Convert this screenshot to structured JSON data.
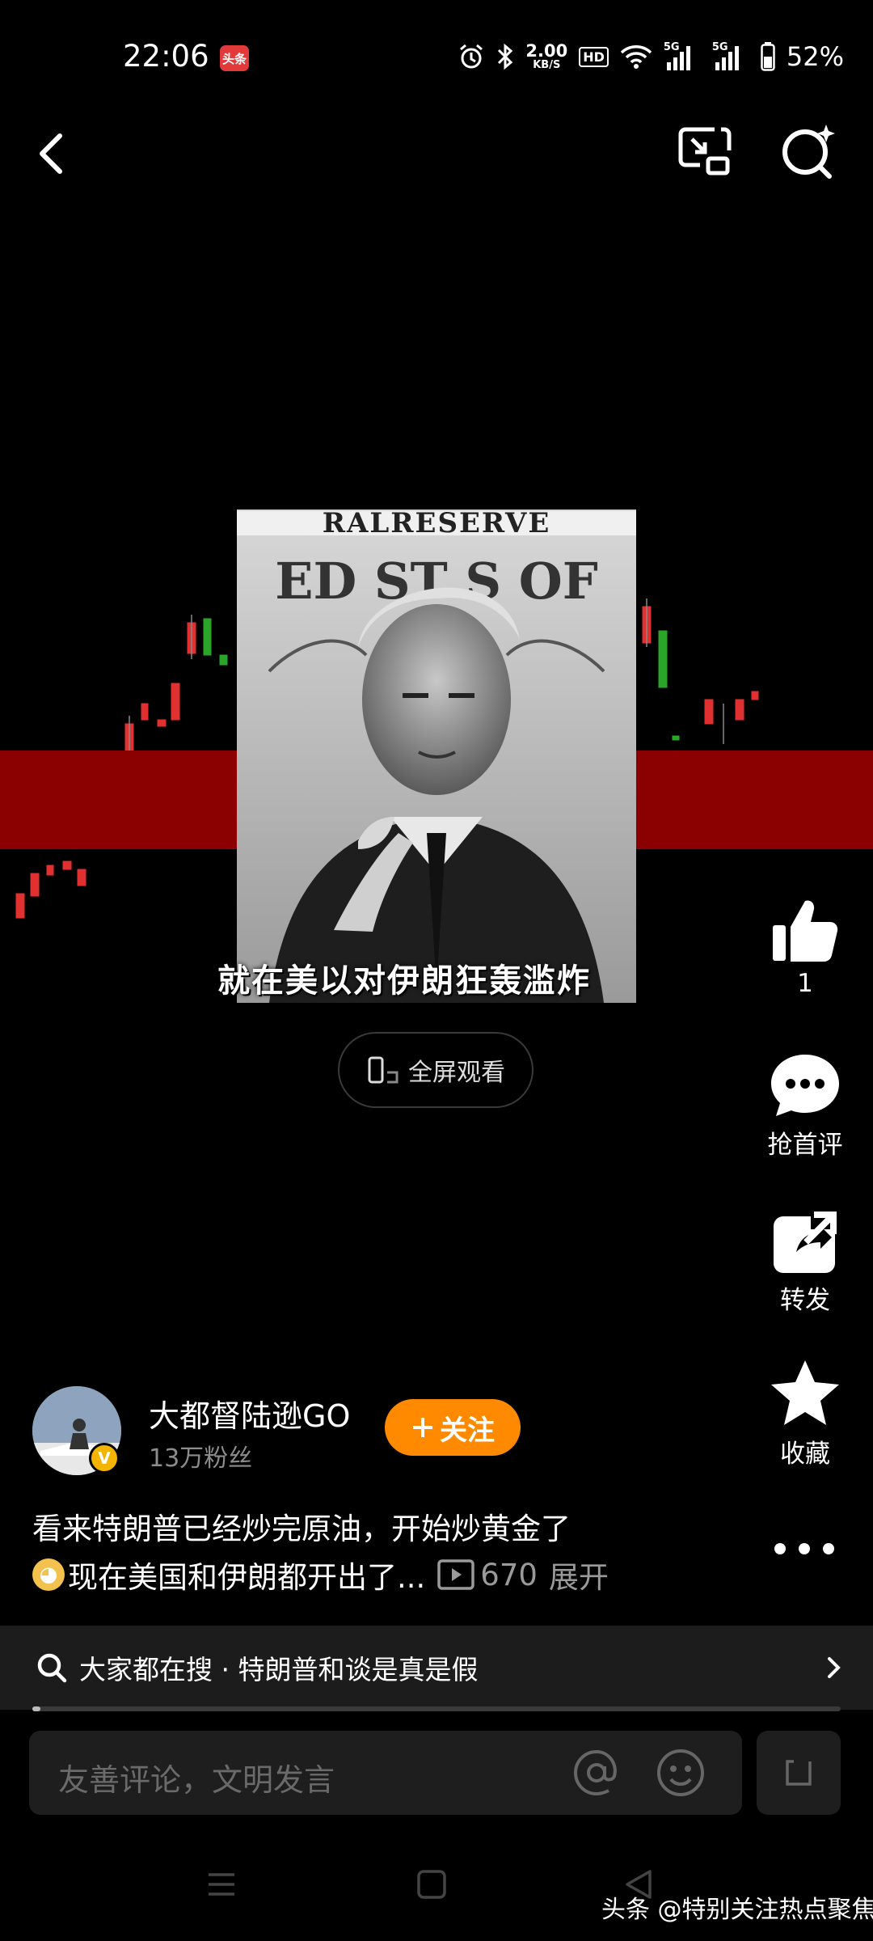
{
  "status_bar": {
    "time": "22:06",
    "app_badge": "头条",
    "net_speed_value": "2.00",
    "net_speed_unit": "KB/S",
    "hd_label": "HD",
    "signal1_label": "5G",
    "signal2_label": "5G",
    "battery": "52%"
  },
  "video": {
    "caption": "就在美以对伊朗狂轰滥炸",
    "fullscreen_label": "全屏观看",
    "poster_text_top": "RALRESERVE",
    "poster_text_mid": "ED ST  S OF"
  },
  "rail": {
    "like_count": "1",
    "comment_label": "抢首评",
    "share_label": "转发",
    "favorite_label": "收藏"
  },
  "author": {
    "name": "大都督陆逊GO",
    "fans": "13万粉丝",
    "follow_label": "关注",
    "verified_mark": "V"
  },
  "post": {
    "line1": "看来特朗普已经炒完原油，开始炒黄金了",
    "line2": "现在美国和伊朗都开出了...",
    "plays": "670",
    "expand": "展开"
  },
  "hot_search": {
    "text": "大家都在搜 · 特朗普和谈是真是假",
    "progress": 0.01
  },
  "comment_bar": {
    "placeholder": "友善评论，文明发言"
  },
  "watermark": "头条 @特别关注热点聚焦",
  "colors": {
    "follow_button": "#ff8a00",
    "red_band": "#8b0000",
    "verified_badge": "#f4b400",
    "app_badge": "#e23a3a"
  }
}
